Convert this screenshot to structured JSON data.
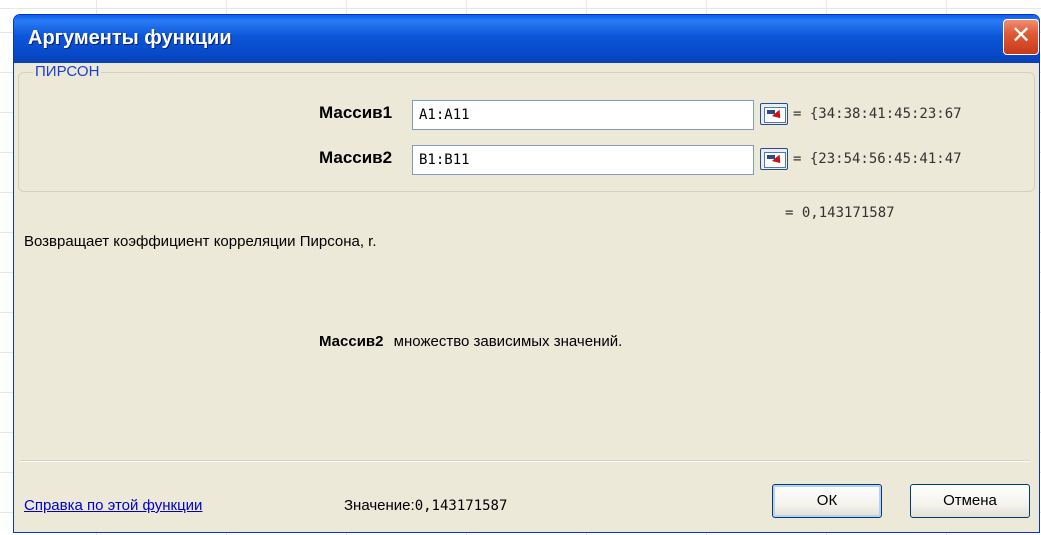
{
  "dialog": {
    "title": "Аргументы функции",
    "close_label": "✕",
    "function_name": "ПИРСОН",
    "arguments": [
      {
        "label": "Массив1",
        "value": "A1:A11",
        "preview": "= {34:38:41:45:23:67"
      },
      {
        "label": "Массив2",
        "value": "B1:B11",
        "preview": "= {23:54:56:45:41:47"
      }
    ],
    "result_preview": "= 0,143171587",
    "description": "Возвращает коэффициент корреляции Пирсона, r.",
    "arg_help": {
      "name": "Массив2",
      "text": "множество зависимых значений."
    },
    "help_link": "Справка по этой функции",
    "value_label": "Значение:",
    "value": "0,143171587",
    "ok_label": "ОК",
    "cancel_label": "Отмена"
  },
  "colors": {
    "titlebar": "#0a56d8",
    "dialog_bg": "#ece9d8",
    "close_button": "#e05a36",
    "link": "#0000cc"
  },
  "icons": {
    "close": "close-icon",
    "ref_button": "collapse-dialog-icon"
  }
}
